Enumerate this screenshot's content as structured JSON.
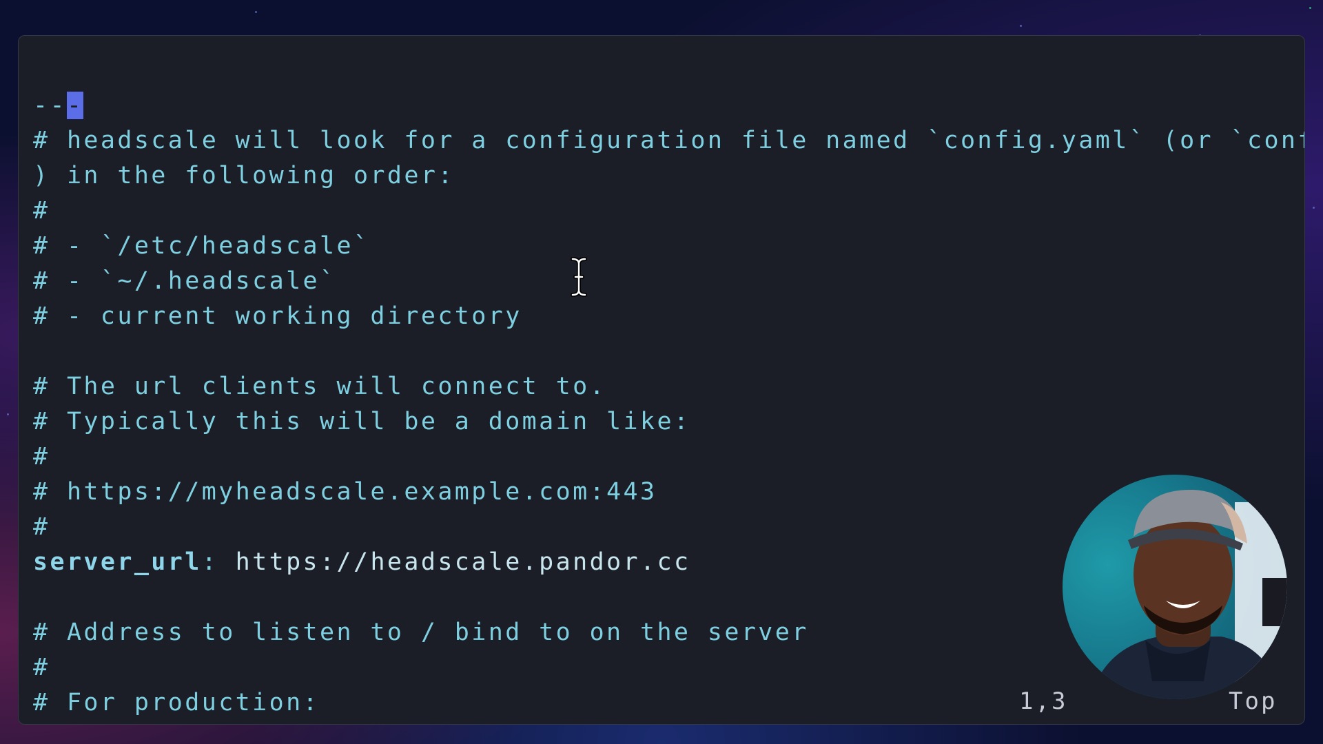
{
  "editor": {
    "cursor_line_prefix": "--",
    "cursor_char": "-",
    "lines": [
      "# headscale will look for a configuration file named `config.yaml` (or `config.json`",
      ") in the following order:",
      "#",
      "# - `/etc/headscale`",
      "# - `~/.headscale`",
      "# - current working directory",
      "",
      "# The url clients will connect to.",
      "# Typically this will be a domain like:",
      "#",
      "# https://myheadscale.example.com:443",
      "#",
      "",
      "",
      "# Address to listen to / bind to on the server",
      "#",
      "# For production:"
    ],
    "server_url_key": "server_url",
    "server_url_sep": ": ",
    "server_url_value": "https://headscale.pandor.cc"
  },
  "statusline": {
    "position": "1,3",
    "scroll": "Top"
  },
  "icons": {
    "mouse_cursor": "text-ibeam-icon",
    "webcam": "presenter-webcam-overlay"
  },
  "colors": {
    "comment": "#7ecfe0",
    "key": "#8fd6ea",
    "cursor_block": "#5b6ee8",
    "background": "#1b1d27"
  }
}
